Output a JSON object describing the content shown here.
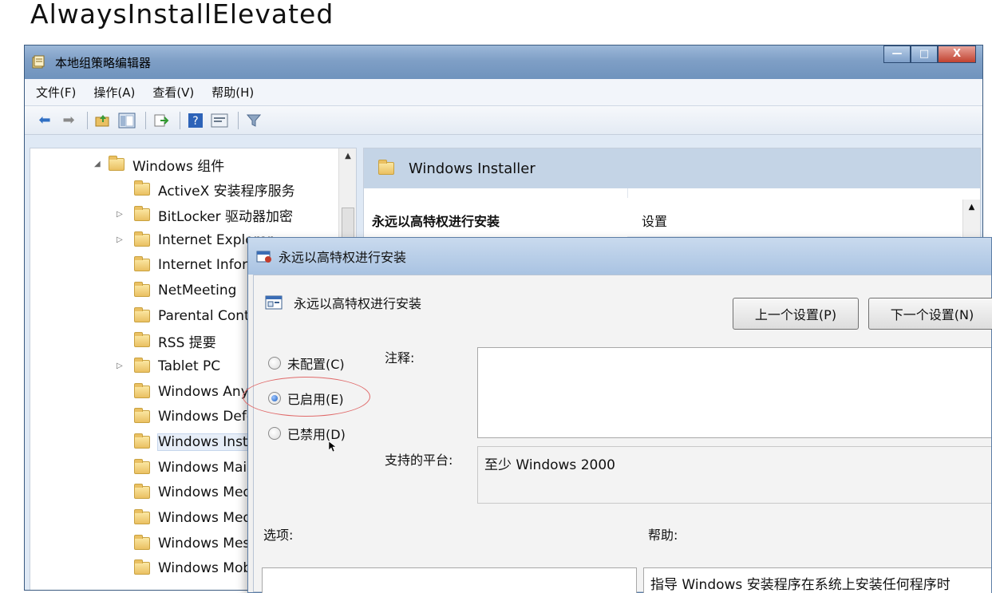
{
  "slide": {
    "title": "AlwaysInstallElevated"
  },
  "window": {
    "title": "本地组策略编辑器",
    "controls": {
      "minimize": "—",
      "maximize": "□",
      "close": "X"
    }
  },
  "menu": [
    "文件(F)",
    "操作(A)",
    "查看(V)",
    "帮助(H)"
  ],
  "tree": {
    "items": [
      {
        "label": "Windows 组件",
        "expander": "◢"
      },
      {
        "label": "ActiveX 安装程序服务"
      },
      {
        "label": "BitLocker 驱动器加密",
        "expander": "▷"
      },
      {
        "label": "Internet Explorer",
        "expander": "▷"
      },
      {
        "label": "Internet Information Services"
      },
      {
        "label": "NetMeeting"
      },
      {
        "label": "Parental Controls"
      },
      {
        "label": "RSS 提要"
      },
      {
        "label": "Tablet PC",
        "expander": "▷"
      },
      {
        "label": "Windows Anytime Upgrade"
      },
      {
        "label": "Windows Defender"
      },
      {
        "label": "Windows Installer"
      },
      {
        "label": "Windows Mail"
      },
      {
        "label": "Windows Media Center"
      },
      {
        "label": "Windows Media Player"
      },
      {
        "label": "Windows Messenger"
      },
      {
        "label": "Windows Mobility Center"
      }
    ]
  },
  "right_pane": {
    "header": "Windows Installer",
    "policy_name": "永远以高特权进行安装",
    "column_header": "设置"
  },
  "dialog": {
    "title": "永远以高特权进行安装",
    "policy_name": "永远以高特权进行安装",
    "prev_button": "上一个设置(P)",
    "next_button": "下一个设置(N)",
    "radio": {
      "not_configured": "未配置(C)",
      "enabled": "已启用(E)",
      "disabled": "已禁用(D)",
      "selected": "enabled"
    },
    "comment_label": "注释:",
    "platform_label": "支持的平台:",
    "platform_value": "至少 Windows 2000",
    "options_label": "选项:",
    "help_label": "帮助:",
    "help_text": "指导 Windows 安装程序在系统上安装任何程序时"
  },
  "colors": {
    "titlebar": "#7f9fc6",
    "right_header": "#c4d4e6",
    "highlight_ellipse": "#e06a6a",
    "radio_selected": "#1d5fc0"
  }
}
